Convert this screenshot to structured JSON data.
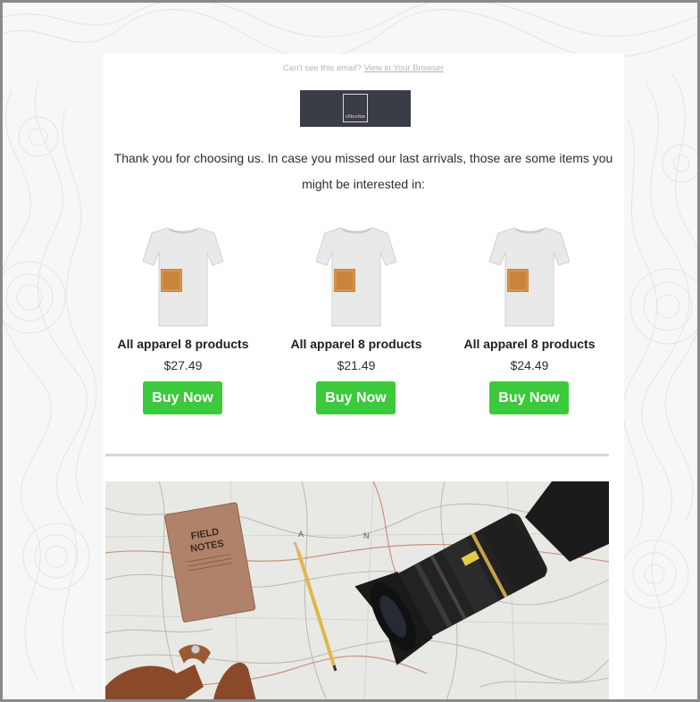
{
  "preheader": {
    "text": "Can't see this email?",
    "link": "View in Your Browser"
  },
  "logo": {
    "text": "cNovibe"
  },
  "intro": {
    "text": "Thank you for choosing us. In case you missed our last arrivals, those are some items you might be interested in:"
  },
  "products": [
    {
      "name": "All apparel 8 products",
      "price": "$27.49",
      "cta": "Buy Now"
    },
    {
      "name": "All apparel 8 products",
      "price": "$21.49",
      "cta": "Buy Now"
    },
    {
      "name": "All apparel 8 products",
      "price": "$24.49",
      "cta": "Buy Now"
    }
  ],
  "hero": {
    "notebook_title_line1": "FIELD",
    "notebook_title_line2": "NOTES",
    "map_letter_1": "A",
    "map_letter_2": "N"
  },
  "colors": {
    "button": "#3cc93b",
    "logo_bg": "#3a3d45",
    "divider": "#d6d6d6",
    "frame_border": "#8a8a8a"
  },
  "icons": [
    "tshirt-product-image",
    "topographic-background",
    "camera-lens",
    "field-notes-notebook",
    "pencil"
  ]
}
